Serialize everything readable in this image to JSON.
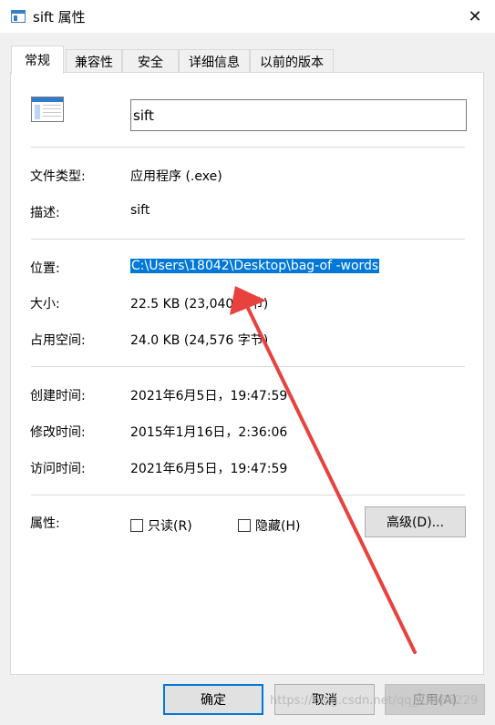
{
  "window": {
    "title": "sift 属性",
    "close_glyph": "✕"
  },
  "tabs": [
    {
      "label": "常规"
    },
    {
      "label": "兼容性"
    },
    {
      "label": "安全"
    },
    {
      "label": "详细信息"
    },
    {
      "label": "以前的版本"
    }
  ],
  "general": {
    "file_name": "sift",
    "rows": {
      "type_label": "文件类型:",
      "type_value": "应用程序 (.exe)",
      "desc_label": "描述:",
      "desc_value": "sift",
      "location_label": "位置:",
      "location_value": "C:\\Users\\18042\\Desktop\\bag-of -words",
      "size_label": "大小:",
      "size_value": "22.5 KB (23,040 字节)",
      "disk_label": "占用空间:",
      "disk_value": "24.0 KB (24,576 字节)",
      "created_label": "创建时间:",
      "created_value": "2021年6月5日，19:47:59",
      "modified_label": "修改时间:",
      "modified_value": "2015年1月16日，2:36:06",
      "accessed_label": "访问时间:",
      "accessed_value": "2021年6月5日，19:47:59",
      "attrs_label": "属性:"
    },
    "attributes": {
      "readonly_label": "只读(R)",
      "readonly_checked": false,
      "hidden_label": "隐藏(H)",
      "hidden_checked": false,
      "advanced_label": "高级(D)..."
    }
  },
  "footer": {
    "ok_label": "确定",
    "cancel_label": "取消",
    "apply_label": "应用(A)"
  },
  "watermark": "https://blog.csdn.net/qq_45588229",
  "colors": {
    "accent": "#0078d7",
    "arrow": "#e8423f"
  },
  "icons": {
    "app": "window-app-icon",
    "file": "exe-file-icon",
    "close": "close-icon"
  }
}
